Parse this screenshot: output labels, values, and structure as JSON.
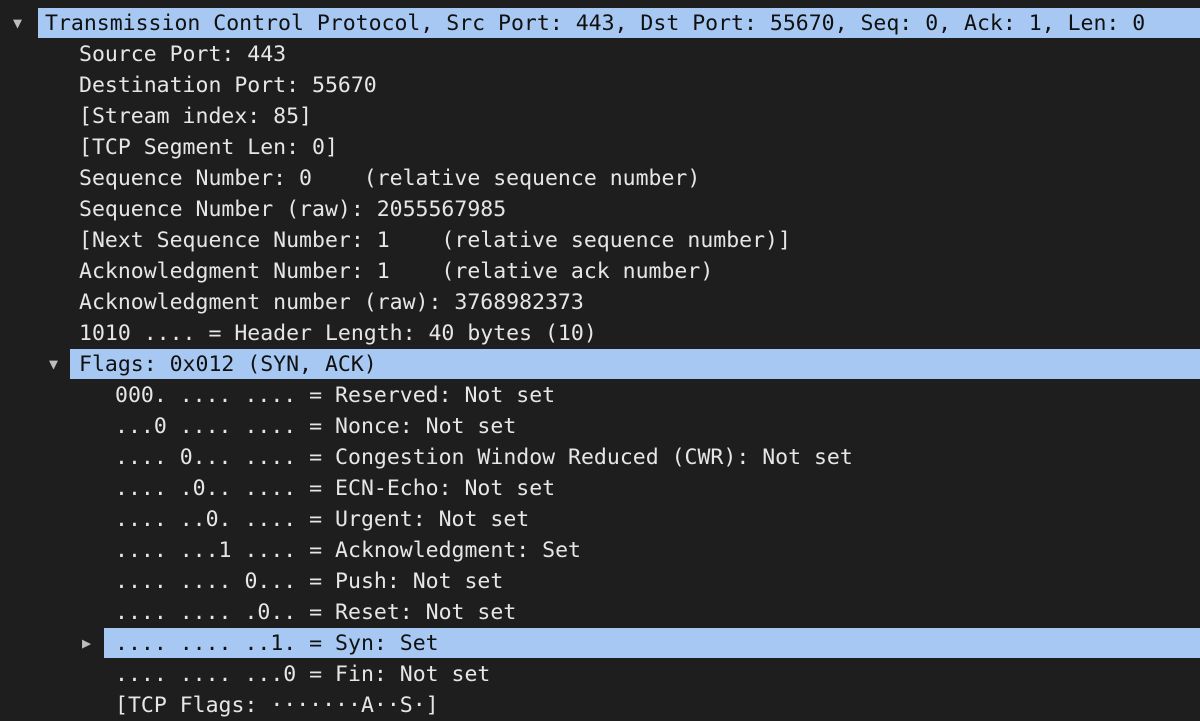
{
  "tree": {
    "nodes": [
      {
        "id": "tcp-header",
        "level": 0,
        "expand": "down",
        "selected": true,
        "text": "Transmission Control Protocol, Src Port: 443, Dst Port: 55670, Seq: 0, Ack: 1, Len: 0"
      },
      {
        "id": "source-port",
        "level": 1,
        "text": "Source Port: 443"
      },
      {
        "id": "destination-port",
        "level": 1,
        "text": "Destination Port: 55670"
      },
      {
        "id": "stream-index",
        "level": 1,
        "text": "[Stream index: 85]"
      },
      {
        "id": "tcp-segment-len",
        "level": 1,
        "text": "[TCP Segment Len: 0]"
      },
      {
        "id": "sequence-number",
        "level": 1,
        "text": "Sequence Number: 0    (relative sequence number)"
      },
      {
        "id": "sequence-number-raw",
        "level": 1,
        "text": "Sequence Number (raw): 2055567985"
      },
      {
        "id": "next-sequence-number",
        "level": 1,
        "text": "[Next Sequence Number: 1    (relative sequence number)]"
      },
      {
        "id": "acknowledgment-number",
        "level": 1,
        "text": "Acknowledgment Number: 1    (relative ack number)"
      },
      {
        "id": "acknowledgment-number-raw",
        "level": 1,
        "text": "Acknowledgment number (raw): 3768982373"
      },
      {
        "id": "header-length",
        "level": 1,
        "text": "1010 .... = Header Length: 40 bytes (10)"
      },
      {
        "id": "flags",
        "level": 1,
        "expand": "down",
        "selected": true,
        "text": "Flags: 0x012 (SYN, ACK)"
      },
      {
        "id": "flag-reserved",
        "level": 2,
        "text": "000. .... .... = Reserved: Not set"
      },
      {
        "id": "flag-nonce",
        "level": 2,
        "text": "...0 .... .... = Nonce: Not set"
      },
      {
        "id": "flag-cwr",
        "level": 2,
        "text": ".... 0... .... = Congestion Window Reduced (CWR): Not set"
      },
      {
        "id": "flag-ecn-echo",
        "level": 2,
        "text": ".... .0.. .... = ECN-Echo: Not set"
      },
      {
        "id": "flag-urgent",
        "level": 2,
        "text": ".... ..0. .... = Urgent: Not set"
      },
      {
        "id": "flag-acknowledgment",
        "level": 2,
        "text": ".... ...1 .... = Acknowledgment: Set"
      },
      {
        "id": "flag-push",
        "level": 2,
        "text": ".... .... 0... = Push: Not set"
      },
      {
        "id": "flag-reset",
        "level": 2,
        "text": ".... .... .0.. = Reset: Not set"
      },
      {
        "id": "flag-syn",
        "level": 2,
        "expand": "right",
        "selected": true,
        "text": ".... .... ..1. = Syn: Set"
      },
      {
        "id": "flag-fin",
        "level": 2,
        "text": ".... .... ...0 = Fin: Not set"
      },
      {
        "id": "tcp-flags-summary",
        "level": 2,
        "text": "[TCP Flags: ·······A··S·]"
      }
    ]
  },
  "icons": {
    "expanded": "triangle-down-icon",
    "collapsed": "triangle-right-icon"
  },
  "colors": {
    "background": "#1e1e1e",
    "text": "#e6e6e6",
    "selection": "#a7c8f2"
  }
}
